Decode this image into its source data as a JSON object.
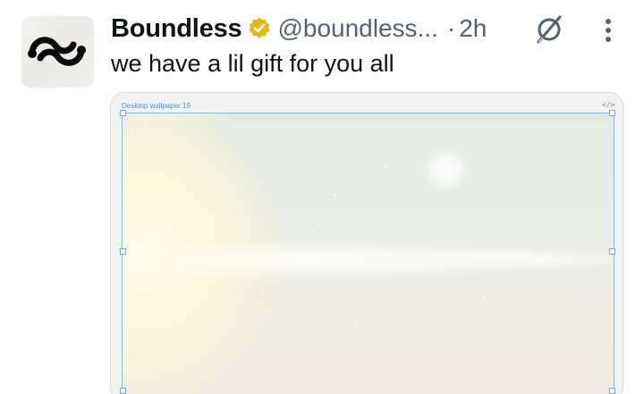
{
  "account": {
    "name": "Boundless",
    "handle": "@boundless...",
    "separator": "·",
    "time": "2h",
    "verified_badge_color": "#e2b719"
  },
  "tweet": {
    "text": "we have a lil gift for you all"
  },
  "media": {
    "label": "Desktop wallpaper 19",
    "code_glyph": "</>"
  },
  "icons": {
    "avatar": "boundless-logo",
    "verified": "verified-badge-icon",
    "grok": "grok-icon",
    "more": "more-vertical-icon"
  },
  "colors": {
    "text_primary": "#0f1419",
    "text_secondary": "#536471",
    "frame_accent": "#8fb8d8"
  }
}
